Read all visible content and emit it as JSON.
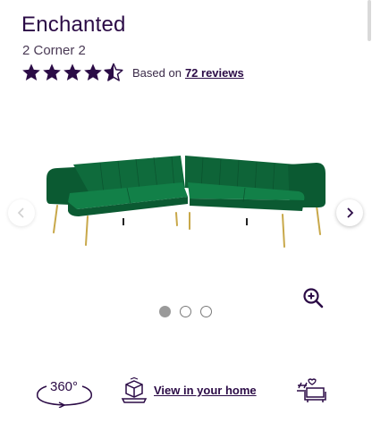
{
  "product": {
    "title": "Enchanted",
    "subtitle": "2 Corner 2"
  },
  "rating": {
    "stars_filled": 4.5,
    "stars_total": 5,
    "based_on_label": "Based on",
    "reviews_link": "72 reviews"
  },
  "gallery": {
    "image_subject": "green velvet corner sofa",
    "current_index": 1,
    "total_images": 3,
    "prev_icon": "chevron-left-icon",
    "next_icon": "chevron-right-icon",
    "zoom_icon": "zoom-in-icon"
  },
  "actions": {
    "spin_label": "360°",
    "ar_label": "View in your home",
    "room_icon": "room-planner-icon"
  },
  "colors": {
    "brand": "#2b0b46",
    "sofa": "#0f6b3c",
    "legs": "#c8a84a"
  }
}
